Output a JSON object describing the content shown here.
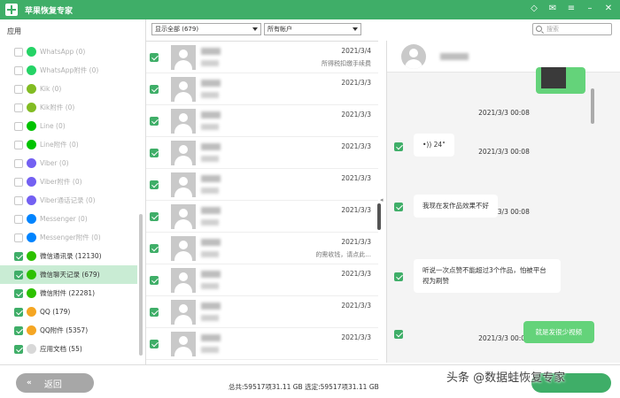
{
  "app": {
    "title": "苹果恢复专家"
  },
  "sidebar": {
    "heading": "应用",
    "items": [
      {
        "label": "WhatsApp (0)",
        "checked": false,
        "disabled": true,
        "icon": "whatsapp-icon",
        "color": "#25d366"
      },
      {
        "label": "WhatsApp附件 (0)",
        "checked": false,
        "disabled": true,
        "icon": "whatsapp-icon",
        "color": "#25d366"
      },
      {
        "label": "Kik (0)",
        "checked": false,
        "disabled": true,
        "icon": "kik-icon",
        "color": "#82bc23"
      },
      {
        "label": "Kik附件 (0)",
        "checked": false,
        "disabled": true,
        "icon": "kik-icon",
        "color": "#82bc23"
      },
      {
        "label": "Line (0)",
        "checked": false,
        "disabled": true,
        "icon": "line-icon",
        "color": "#00c300"
      },
      {
        "label": "Line附件 (0)",
        "checked": false,
        "disabled": true,
        "icon": "line-icon",
        "color": "#00c300"
      },
      {
        "label": "Viber (0)",
        "checked": false,
        "disabled": true,
        "icon": "viber-icon",
        "color": "#7360f2"
      },
      {
        "label": "Viber附件 (0)",
        "checked": false,
        "disabled": true,
        "icon": "viber-icon",
        "color": "#7360f2"
      },
      {
        "label": "Viber通话记录 (0)",
        "checked": false,
        "disabled": true,
        "icon": "viber-icon",
        "color": "#7360f2"
      },
      {
        "label": "Messenger (0)",
        "checked": false,
        "disabled": true,
        "icon": "messenger-icon",
        "color": "#0084ff"
      },
      {
        "label": "Messenger附件 (0)",
        "checked": false,
        "disabled": true,
        "icon": "messenger-icon",
        "color": "#0084ff"
      },
      {
        "label": "微信通讯录 (12130)",
        "checked": true,
        "disabled": false,
        "icon": "wechat-icon",
        "color": "#2dc100"
      },
      {
        "label": "微信聊天记录 (679)",
        "checked": true,
        "disabled": false,
        "active": true,
        "icon": "wechat-icon",
        "color": "#2dc100"
      },
      {
        "label": "微信附件 (22281)",
        "checked": true,
        "disabled": false,
        "icon": "wechat-icon",
        "color": "#2dc100"
      },
      {
        "label": "QQ (179)",
        "checked": true,
        "disabled": false,
        "icon": "qq-icon",
        "color": "#f5a623"
      },
      {
        "label": "QQ附件 (5357)",
        "checked": true,
        "disabled": false,
        "icon": "qq-icon",
        "color": "#f5a623"
      },
      {
        "label": "应用文档 (55)",
        "checked": true,
        "disabled": false,
        "icon": "document-icon",
        "color": "#d8d8d8"
      }
    ]
  },
  "filters": {
    "show_all": "显示全部 (679)",
    "accounts": "所有帐户",
    "search_placeholder": "搜索"
  },
  "conversations": [
    {
      "date": "2021/3/4",
      "snippet": "所得税扣缴手续费"
    },
    {
      "date": "2021/3/3",
      "snippet": ""
    },
    {
      "date": "2021/3/3",
      "snippet": ""
    },
    {
      "date": "2021/3/3",
      "snippet": ""
    },
    {
      "date": "2021/3/3",
      "snippet": ""
    },
    {
      "date": "2021/3/3",
      "snippet": ""
    },
    {
      "date": "2021/3/3",
      "snippet": "的需收钱，请点此..."
    },
    {
      "date": "2021/3/3",
      "snippet": ""
    },
    {
      "date": "2021/3/3",
      "snippet": ""
    },
    {
      "date": "2021/3/3",
      "snippet": ""
    }
  ],
  "chat": {
    "messages": [
      {
        "time": "2021/3/3 00:08",
        "text": "•)) 24\"",
        "dir": "in"
      },
      {
        "time": "2021/3/3 00:08",
        "text": "我现在发作品效果不好",
        "dir": "in"
      },
      {
        "time": "2021/3/3 00:08",
        "text": "听说一次点赞不能超过3个作品，怕被平台视为刷赞",
        "dir": "in"
      },
      {
        "time": "2021/3/3 00:08",
        "text": "就是发很少视频",
        "dir": "out"
      },
      {
        "time": "2021/3/3 00:09",
        "text": "",
        "dir": "none"
      }
    ],
    "first_time": "2021/3/3 00:08"
  },
  "footer": {
    "back_label": "返回",
    "summary": "总共:59517项31.11 GB 选定:59517项31.11 GB",
    "watermark": "头条 @数据蛙恢复专家"
  },
  "colors": {
    "brand": "#3fae68",
    "bubble_out": "#64d37a",
    "active_row": "#c9ecd4"
  }
}
